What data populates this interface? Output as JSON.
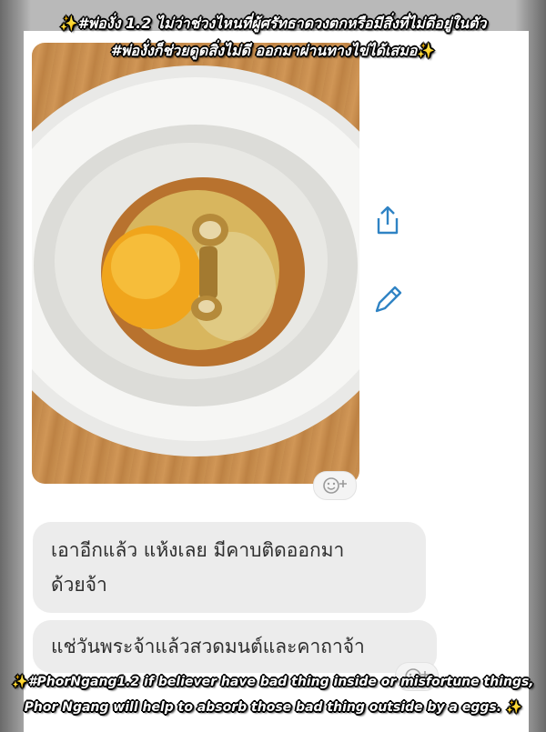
{
  "caption_top": {
    "line1": "#พ่องั่ง 1.2 ไม่ว่าช่วงไหนที่ผู้ศรัทธาดวงตกหรือมีสิ่งที่ไม่ดีอยู่ในตัว",
    "line2": "#พ่องั่งก็ช่วยดูดสิ่งไม่ดี ออกมาผ่านทางไข่ได้เสมอ"
  },
  "caption_bottom": {
    "line1": "#PhorNgang1.2 if believer have bad thing inside or misfortune things,",
    "line2": "Phor Ngang will help to absorb those bad thing outside by a eggs."
  },
  "sparkle": "✨",
  "icons": {
    "share": "share-icon",
    "edit": "edit-pencil-icon",
    "reaction": "add-reaction-icon"
  },
  "messages": [
    {
      "line1": "เอาอีกแล้ว แห้งเลย มีคาบติดออกมา",
      "line2": "ด้วยจ้า"
    },
    {
      "line1": "แช่วันพระจ้าแล้วสวดมนต์และคาถาจ้า"
    }
  ],
  "colors": {
    "accent": "#2f83c4",
    "bubble": "#ececec",
    "caption_text": "#ffffff",
    "sparkle": "#f5d050"
  }
}
